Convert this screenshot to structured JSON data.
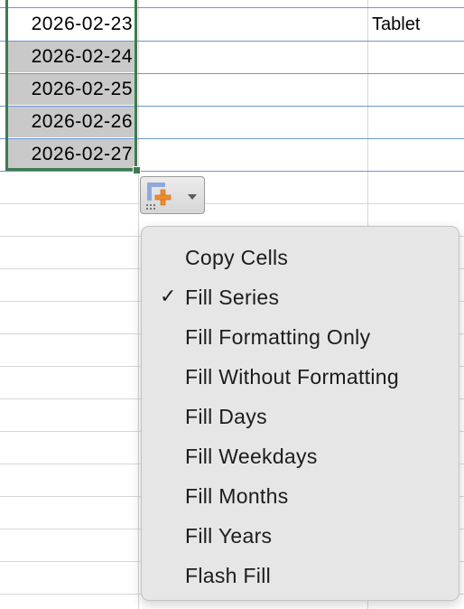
{
  "cells": {
    "dates": [
      "2026-02-23",
      "2026-02-24",
      "2026-02-25",
      "2026-02-26",
      "2026-02-27"
    ],
    "other_value": "Tablet"
  },
  "autofill_button": {
    "icon": "autofill-options-icon",
    "dropdown_icon": "chevron-down-icon"
  },
  "menu": {
    "items": [
      {
        "label": "Copy Cells",
        "checked": false
      },
      {
        "label": "Fill Series",
        "checked": true
      },
      {
        "label": "Fill Formatting Only",
        "checked": false
      },
      {
        "label": "Fill Without Formatting",
        "checked": false
      },
      {
        "label": "Fill Days",
        "checked": false
      },
      {
        "label": "Fill Weekdays",
        "checked": false
      },
      {
        "label": "Fill Months",
        "checked": false
      },
      {
        "label": "Fill Years",
        "checked": false
      },
      {
        "label": "Flash Fill",
        "checked": false
      }
    ],
    "check_glyph": "✓"
  },
  "colors": {
    "selection_border": "#3f7a4d",
    "selected_fill": "#c9c9c9",
    "row_border_blue": "#6d97d3",
    "menu_background": "#e6e6e6",
    "autofill_icon_orange": "#f08c2c",
    "autofill_icon_blue": "#8fa9dd"
  }
}
